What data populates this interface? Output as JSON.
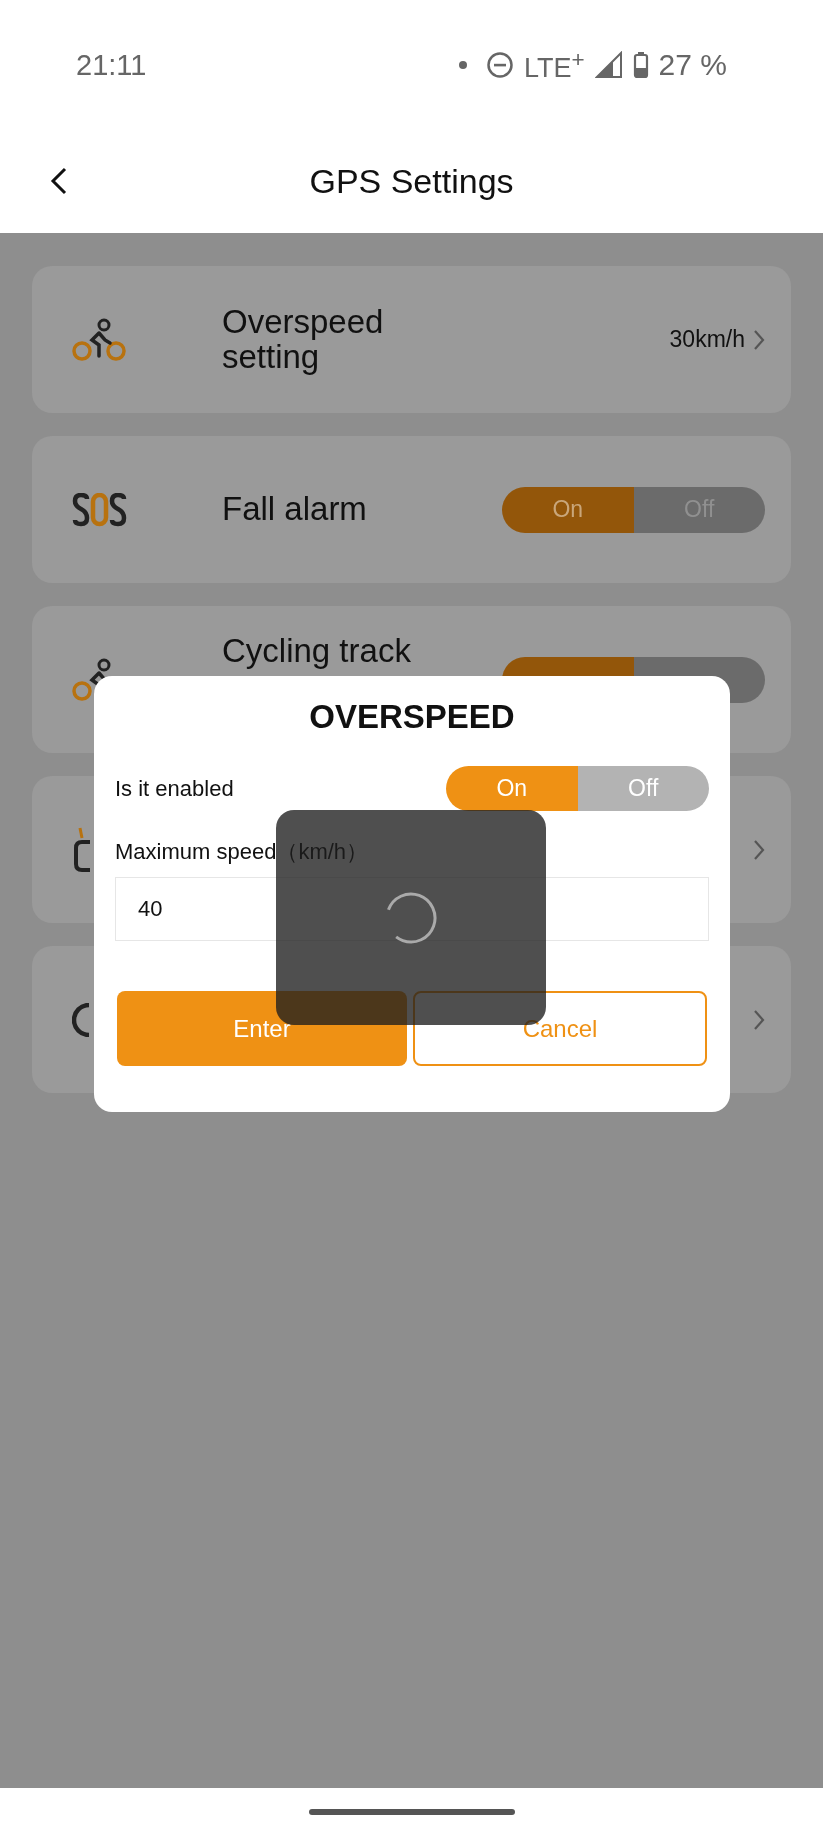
{
  "status_bar": {
    "time": "21:11",
    "network": "LTE$^{+}$",
    "battery": "27 %"
  },
  "header": {
    "title": "GPS Settings"
  },
  "rows": [
    {
      "kind": "value",
      "title": "Overspeed setting",
      "value": "30km/h"
    },
    {
      "kind": "toggle",
      "title": "Fall alarm",
      "on": true,
      "on_label": "On",
      "off_label": "Off"
    },
    {
      "kind": "toggle",
      "title": "Cycling track",
      "on": true
    },
    {
      "kind": "link"
    },
    {
      "kind": "link"
    }
  ],
  "dialog": {
    "title": "OVERSPEED",
    "enabled_label": "Is it enabled",
    "enabled": true,
    "on_label": "On",
    "off_label": "Off",
    "speed_label": "Maximum speed（km/h）",
    "speed_value": "40",
    "buttons": [
      {
        "kind": "primary",
        "label": "Enter"
      },
      {
        "kind": "secondary",
        "label": "Cancel"
      }
    ],
    "loading": true
  }
}
